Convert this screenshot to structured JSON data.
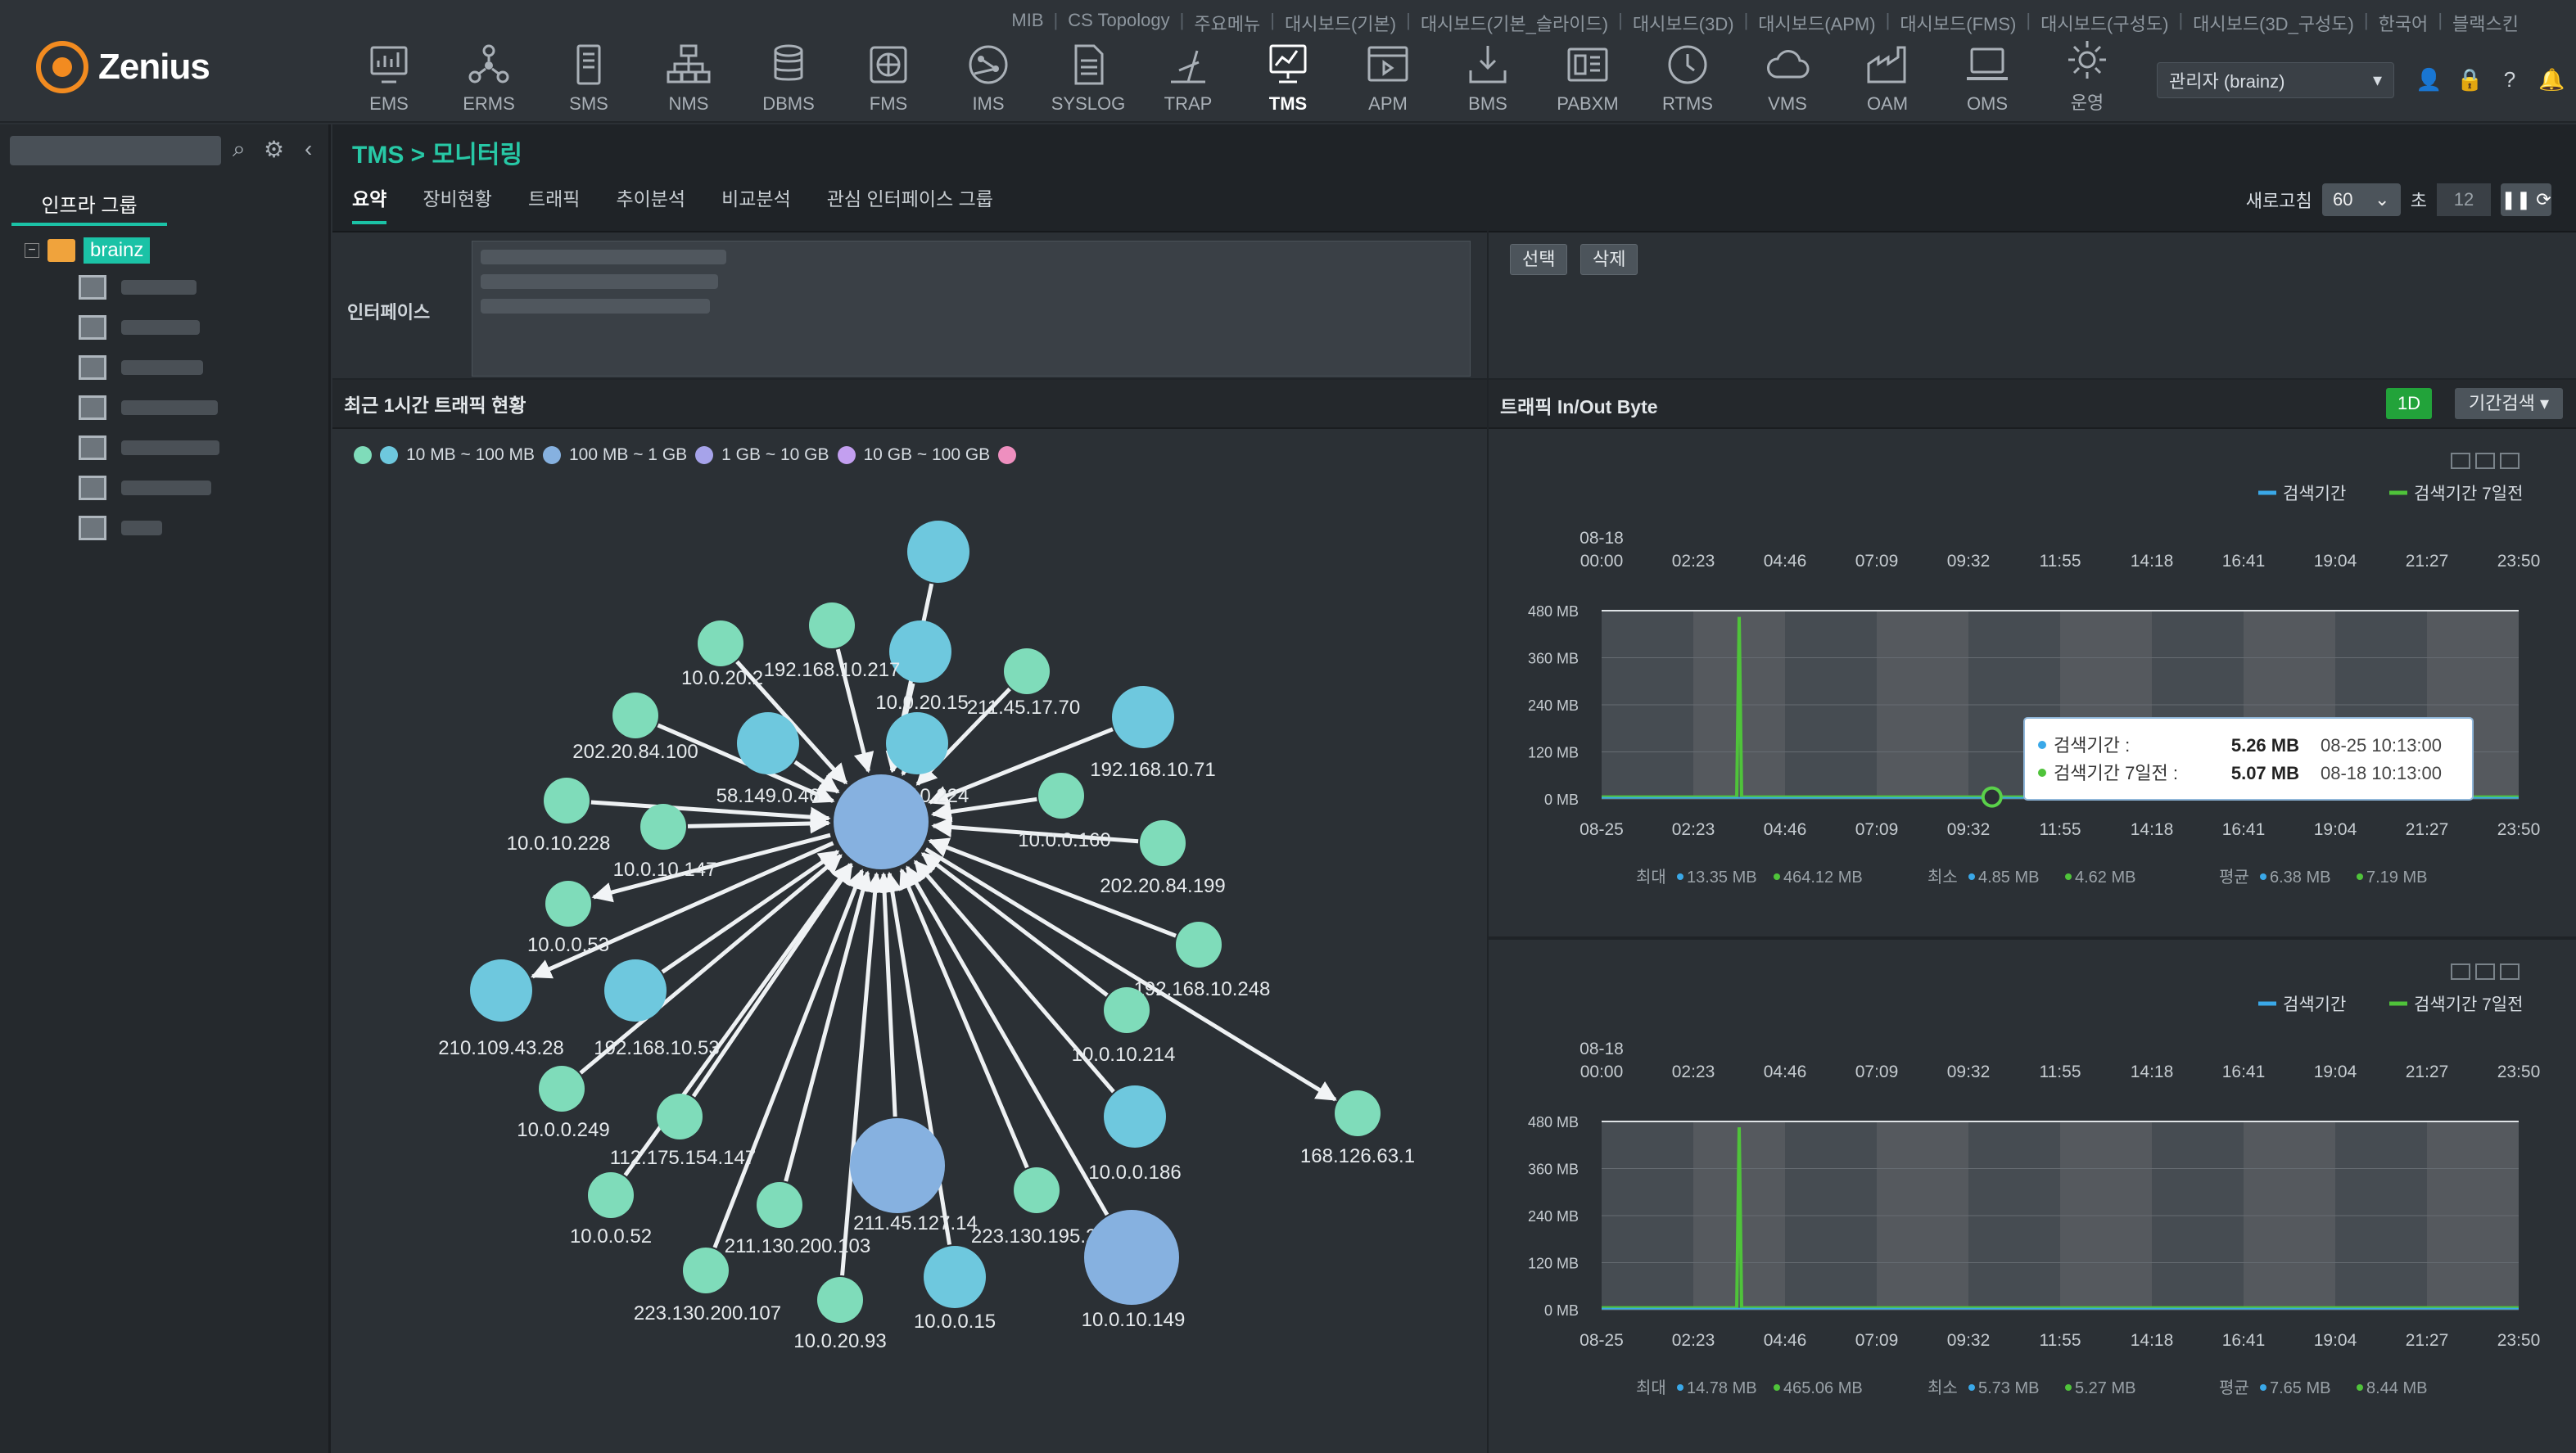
{
  "app": {
    "logo": "Zenius"
  },
  "toplinks": [
    "MIB",
    "CS Topology",
    "주요메뉴",
    "대시보드(기본)",
    "대시보드(기본_슬라이드)",
    "대시보드(3D)",
    "대시보드(APM)",
    "대시보드(FMS)",
    "대시보드(구성도)",
    "대시보드(3D_구성도)",
    "한국어",
    "블랙스킨"
  ],
  "menus": [
    {
      "label": "EMS",
      "icon": "monitor-chart-icon"
    },
    {
      "label": "ERMS",
      "icon": "network-nodes-icon"
    },
    {
      "label": "SMS",
      "icon": "server-icon"
    },
    {
      "label": "NMS",
      "icon": "network-tree-icon"
    },
    {
      "label": "DBMS",
      "icon": "database-icon"
    },
    {
      "label": "FMS",
      "icon": "fan-box-icon"
    },
    {
      "label": "IMS",
      "icon": "globe-nodes-icon"
    },
    {
      "label": "SYSLOG",
      "icon": "document-icon"
    },
    {
      "label": "TRAP",
      "icon": "antenna-icon"
    },
    {
      "label": "TMS",
      "icon": "traffic-monitor-icon"
    },
    {
      "label": "APM",
      "icon": "browser-window-icon"
    },
    {
      "label": "BMS",
      "icon": "download-tray-icon"
    },
    {
      "label": "PABXM",
      "icon": "pabx-icon"
    },
    {
      "label": "RTMS",
      "icon": "clock-icon"
    },
    {
      "label": "VMS",
      "icon": "cloud-icon"
    },
    {
      "label": "OAM",
      "icon": "factory-icon"
    },
    {
      "label": "OMS",
      "icon": "laptop-icon"
    },
    {
      "label": "운영",
      "icon": "gear-icon"
    }
  ],
  "user": {
    "name": "관리자 (brainz)"
  },
  "sidebar": {
    "tab": "인프라 그룹",
    "root": "brainz",
    "item_count": 7
  },
  "breadcrumb": "TMS > 모니터링",
  "tabs": [
    "요약",
    "장비현황",
    "트래픽",
    "추이분석",
    "비교분석",
    "관심 인터페이스 그룹"
  ],
  "refresh": {
    "label": "새로고침",
    "value": "60",
    "unit": "초",
    "count": "12"
  },
  "interface": {
    "label": "인터페이스"
  },
  "buttons": {
    "select": "선택",
    "delete": "삭제",
    "period": "1D",
    "period_search": "기간검색"
  },
  "left_panel": {
    "title": "최근 1시간 트래픽 현황"
  },
  "legend": [
    {
      "label": "",
      "color": "#7fdcba"
    },
    {
      "label": "10 MB ~ 100 MB",
      "color": "#6ec8de"
    },
    {
      "label": "100 MB ~ 1 GB",
      "color": "#86b1e0"
    },
    {
      "label": "1 GB ~ 10 GB",
      "color": "#a6a3ea"
    },
    {
      "label": "10 GB ~ 100 GB",
      "color": "#c39ff0"
    },
    {
      "label": "",
      "color": "#ee8fbf"
    }
  ],
  "right_panel": {
    "title": "트래픽 In/Out Byte"
  },
  "chart_data": [
    {
      "type": "line",
      "series": [
        {
          "name": "검색기간",
          "color": "#3aa8e8"
        },
        {
          "name": "검색기간 7일전",
          "color": "#4fc33a"
        }
      ],
      "x_top_date": "08-18",
      "x_top": [
        "00:00",
        "02:23",
        "04:46",
        "07:09",
        "09:32",
        "11:55",
        "14:18",
        "16:41",
        "19:04",
        "21:27",
        "23:50"
      ],
      "x_bottom_date": "08-25",
      "x_bottom": [
        "",
        "02:23",
        "04:46",
        "07:09",
        "09:32",
        "11:55",
        "14:18",
        "16:41",
        "19:04",
        "21:27",
        "23:50"
      ],
      "y_ticks": [
        "0 MB",
        "120 MB",
        "240 MB",
        "360 MB",
        "480 MB"
      ],
      "ylim": [
        0,
        480
      ],
      "spike": {
        "at_hour": 3.6,
        "value_mb": 464.12
      },
      "tooltip": [
        {
          "label": "검색기간 :",
          "value": "5.26 MB",
          "time": "08-25 10:13:00"
        },
        {
          "label": "검색기간 7일전 :",
          "value": "5.07 MB",
          "time": "08-18 10:13:00"
        }
      ],
      "stats": [
        {
          "label": "최대",
          "a": "13.35 MB",
          "b": "464.12 MB"
        },
        {
          "label": "최소",
          "a": "4.85 MB",
          "b": "4.62 MB"
        },
        {
          "label": "평균",
          "a": "6.38 MB",
          "b": "7.19 MB"
        }
      ]
    },
    {
      "type": "line",
      "series": [
        {
          "name": "검색기간",
          "color": "#3aa8e8"
        },
        {
          "name": "검색기간 7일전",
          "color": "#4fc33a"
        }
      ],
      "x_top_date": "08-18",
      "x_top": [
        "00:00",
        "02:23",
        "04:46",
        "07:09",
        "09:32",
        "11:55",
        "14:18",
        "16:41",
        "19:04",
        "21:27",
        "23:50"
      ],
      "x_bottom_date": "08-25",
      "x_bottom": [
        "",
        "02:23",
        "04:46",
        "07:09",
        "09:32",
        "11:55",
        "14:18",
        "16:41",
        "19:04",
        "21:27",
        "23:50"
      ],
      "y_ticks": [
        "0 MB",
        "120 MB",
        "240 MB",
        "360 MB",
        "480 MB"
      ],
      "ylim": [
        0,
        480
      ],
      "spike": {
        "at_hour": 3.6,
        "value_mb": 465.06
      },
      "stats": [
        {
          "label": "최대",
          "a": "14.78 MB",
          "b": "465.06 MB"
        },
        {
          "label": "최소",
          "a": "5.73 MB",
          "b": "5.27 MB"
        },
        {
          "label": "평균",
          "a": "7.65 MB",
          "b": "8.44 MB"
        }
      ]
    }
  ],
  "graph": {
    "center": {
      "label": "",
      "tier": 2
    },
    "nodes": [
      {
        "label": "",
        "tier": 1
      },
      {
        "label": "10.0.20.15",
        "tier": 1
      },
      {
        "label": "10.0.20.2",
        "tier": 0
      },
      {
        "label": "192.168.10.217",
        "tier": 0
      },
      {
        "label": "211.45.17.70",
        "tier": 0
      },
      {
        "label": "192.168.10.71",
        "tier": 1
      },
      {
        "label": "202.20.84.100",
        "tier": 0
      },
      {
        "label": "10.0.10.224",
        "tier": 1
      },
      {
        "label": "10.0.0.160",
        "tier": 0
      },
      {
        "label": "58.149.0.46",
        "tier": 1
      },
      {
        "label": "202.20.84.199",
        "tier": 0
      },
      {
        "label": "10.0.10.228",
        "tier": 0
      },
      {
        "label": "10.0.10.147",
        "tier": 0
      },
      {
        "label": "192.168.10.248",
        "tier": 0
      },
      {
        "label": "10.0.0.53",
        "tier": 0
      },
      {
        "label": "210.109.43.28",
        "tier": 1
      },
      {
        "label": "192.168.10.53",
        "tier": 1
      },
      {
        "label": "10.0.10.214",
        "tier": 0
      },
      {
        "label": "10.0.0.249",
        "tier": 0
      },
      {
        "label": "112.175.154.147",
        "tier": 0
      },
      {
        "label": "10.0.0.186",
        "tier": 1
      },
      {
        "label": "168.126.63.1",
        "tier": 0
      },
      {
        "label": "10.0.0.52",
        "tier": 0
      },
      {
        "label": "211.130.200.103",
        "tier": 0
      },
      {
        "label": "211.45.127.14",
        "tier": 2
      },
      {
        "label": "223.130.195.200",
        "tier": 0
      },
      {
        "label": "223.130.200.107",
        "tier": 0
      },
      {
        "label": "10.0.20.93",
        "tier": 0
      },
      {
        "label": "10.0.0.15",
        "tier": 1
      },
      {
        "label": "10.0.10.149",
        "tier": 2
      }
    ]
  }
}
